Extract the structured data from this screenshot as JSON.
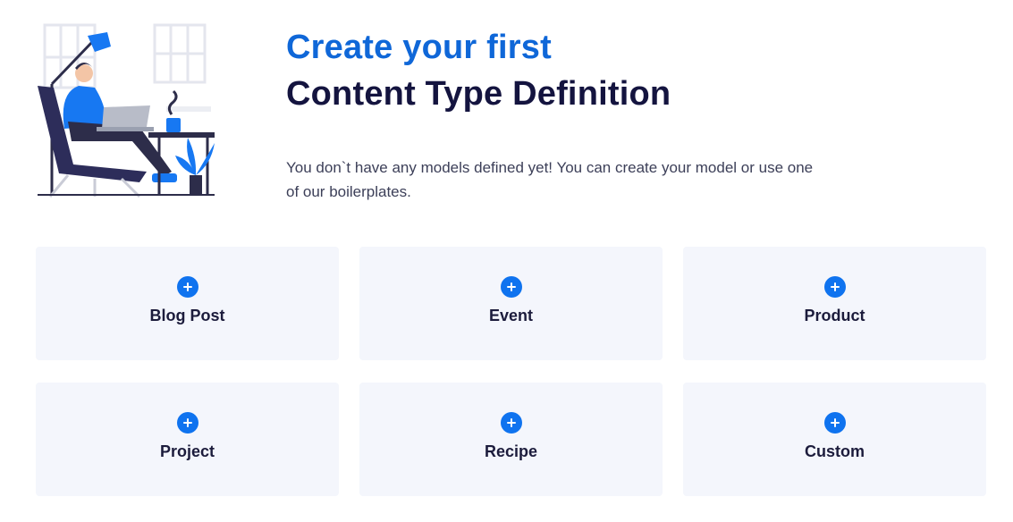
{
  "hero": {
    "title_accent": "Create your first",
    "title_main": "Content Type Definition",
    "description": "You don`t have any models defined yet! You can create your model or use one of our boilerplates."
  },
  "boilerplates": [
    {
      "label": "Blog Post",
      "icon": "plus-circle-icon"
    },
    {
      "label": "Event",
      "icon": "plus-circle-icon"
    },
    {
      "label": "Product",
      "icon": "plus-circle-icon"
    },
    {
      "label": "Project",
      "icon": "plus-circle-icon"
    },
    {
      "label": "Recipe",
      "icon": "plus-circle-icon"
    },
    {
      "label": "Custom",
      "icon": "plus-circle-icon"
    }
  ],
  "colors": {
    "accent": "#0f67d8",
    "heading": "#14143f",
    "card_bg": "#f4f6fc",
    "icon_bg": "#0f73ef"
  }
}
